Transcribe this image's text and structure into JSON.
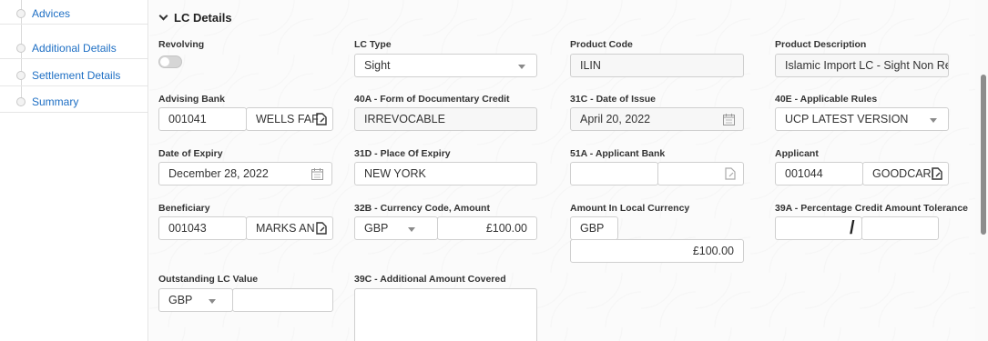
{
  "sidebar": {
    "items": [
      {
        "label": "Advices"
      },
      {
        "label": "Additional Details"
      },
      {
        "label": "Settlement Details"
      },
      {
        "label": "Summary"
      }
    ]
  },
  "section": {
    "title": "LC Details"
  },
  "fields": {
    "revolving": {
      "label": "Revolving",
      "value": false
    },
    "lc_type": {
      "label": "LC Type",
      "value": "Sight"
    },
    "product_code": {
      "label": "Product Code",
      "value": "ILIN"
    },
    "product_description": {
      "label": "Product Description",
      "value": "Islamic Import LC - Sight Non Revolv"
    },
    "advising_bank": {
      "label": "Advising Bank",
      "code": "001041",
      "name": "WELLS FAF"
    },
    "form_of_credit": {
      "label": "40A - Form of Documentary Credit",
      "value": "IRREVOCABLE"
    },
    "date_of_issue": {
      "label": "31C - Date of Issue",
      "value": "April 20, 2022"
    },
    "applicable_rules": {
      "label": "40E - Applicable Rules",
      "value": "UCP LATEST VERSION"
    },
    "date_of_expiry": {
      "label": "Date of Expiry",
      "value": "December 28, 2022"
    },
    "place_of_expiry": {
      "label": "31D - Place Of Expiry",
      "value": "NEW YORK"
    },
    "applicant_bank": {
      "label": "51A - Applicant Bank",
      "code": "",
      "name": ""
    },
    "applicant": {
      "label": "Applicant",
      "code": "001044",
      "name": "GOODCARI"
    },
    "beneficiary": {
      "label": "Beneficiary",
      "code": "001043",
      "name": "MARKS AN"
    },
    "currency_amount": {
      "label": "32B - Currency Code, Amount",
      "currency": "GBP",
      "amount": "£100.00"
    },
    "amount_local": {
      "label": "Amount In Local Currency",
      "currency": "GBP",
      "amount": "£100.00"
    },
    "tolerance": {
      "label": "39A - Percentage Credit Amount Tolerance",
      "separator": "/"
    },
    "outstanding_value": {
      "label": "Outstanding LC Value",
      "currency": "GBP",
      "amount": ""
    },
    "additional_amount": {
      "label": "39C - Additional Amount Covered",
      "value": ""
    }
  },
  "icons": {
    "lookup": "lookup-icon",
    "calendar": "calendar-icon",
    "dropdown": "chevron-down-icon"
  },
  "colors": {
    "link": "#1e6fc4",
    "border": "#cfcfcf"
  }
}
